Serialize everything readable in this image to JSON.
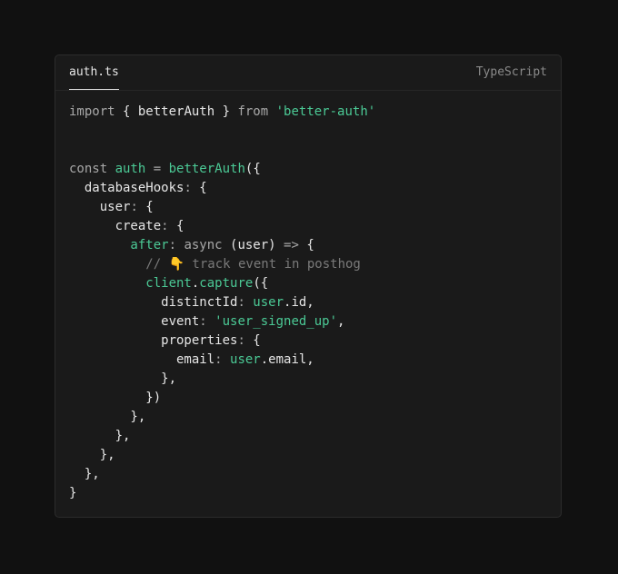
{
  "editor": {
    "filename": "auth.ts",
    "language": "TypeScript",
    "colors": {
      "background": "#111111",
      "panel": "#1a1a1a",
      "keyword": "#a8a8a8",
      "plain": "#e6e6e6",
      "accent": "#4bc995",
      "comment": "#7a7a7a"
    },
    "lines": [
      [
        {
          "t": "import ",
          "c": "k"
        },
        {
          "t": "{ betterAuth } ",
          "c": "p"
        },
        {
          "t": "from ",
          "c": "k"
        },
        {
          "t": "'better-auth'",
          "c": "s"
        }
      ],
      [],
      [],
      [
        {
          "t": "const ",
          "c": "k"
        },
        {
          "t": "auth ",
          "c": "g"
        },
        {
          "t": "= ",
          "c": "k"
        },
        {
          "t": "betterAuth",
          "c": "g"
        },
        {
          "t": "({",
          "c": "p"
        }
      ],
      [
        {
          "t": "  databaseHooks",
          "c": "p"
        },
        {
          "t": ": ",
          "c": "k"
        },
        {
          "t": "{",
          "c": "p"
        }
      ],
      [
        {
          "t": "    user",
          "c": "p"
        },
        {
          "t": ": ",
          "c": "k"
        },
        {
          "t": "{",
          "c": "p"
        }
      ],
      [
        {
          "t": "      create",
          "c": "p"
        },
        {
          "t": ": ",
          "c": "k"
        },
        {
          "t": "{",
          "c": "p"
        }
      ],
      [
        {
          "t": "        after",
          "c": "g"
        },
        {
          "t": ": ",
          "c": "k"
        },
        {
          "t": "async ",
          "c": "k"
        },
        {
          "t": "(user) ",
          "c": "p"
        },
        {
          "t": "=> ",
          "c": "k"
        },
        {
          "t": "{",
          "c": "p"
        }
      ],
      [
        {
          "t": "          // 👇 track event in posthog",
          "c": "c"
        }
      ],
      [
        {
          "t": "          client",
          "c": "g"
        },
        {
          "t": ".",
          "c": "p"
        },
        {
          "t": "capture",
          "c": "g"
        },
        {
          "t": "({",
          "c": "p"
        }
      ],
      [
        {
          "t": "            distinctId",
          "c": "p"
        },
        {
          "t": ": ",
          "c": "k"
        },
        {
          "t": "user",
          "c": "g"
        },
        {
          "t": ".id,",
          "c": "p"
        }
      ],
      [
        {
          "t": "            event",
          "c": "p"
        },
        {
          "t": ": ",
          "c": "k"
        },
        {
          "t": "'user_signed_up'",
          "c": "s"
        },
        {
          "t": ",",
          "c": "p"
        }
      ],
      [
        {
          "t": "            properties",
          "c": "p"
        },
        {
          "t": ": ",
          "c": "k"
        },
        {
          "t": "{",
          "c": "p"
        }
      ],
      [
        {
          "t": "              email",
          "c": "p"
        },
        {
          "t": ": ",
          "c": "k"
        },
        {
          "t": "user",
          "c": "g"
        },
        {
          "t": ".email,",
          "c": "p"
        }
      ],
      [
        {
          "t": "            },",
          "c": "p"
        }
      ],
      [
        {
          "t": "          })",
          "c": "p"
        }
      ],
      [
        {
          "t": "        },",
          "c": "p"
        }
      ],
      [
        {
          "t": "      },",
          "c": "p"
        }
      ],
      [
        {
          "t": "    },",
          "c": "p"
        }
      ],
      [
        {
          "t": "  },",
          "c": "p"
        }
      ],
      [
        {
          "t": "}",
          "c": "p"
        }
      ]
    ]
  }
}
